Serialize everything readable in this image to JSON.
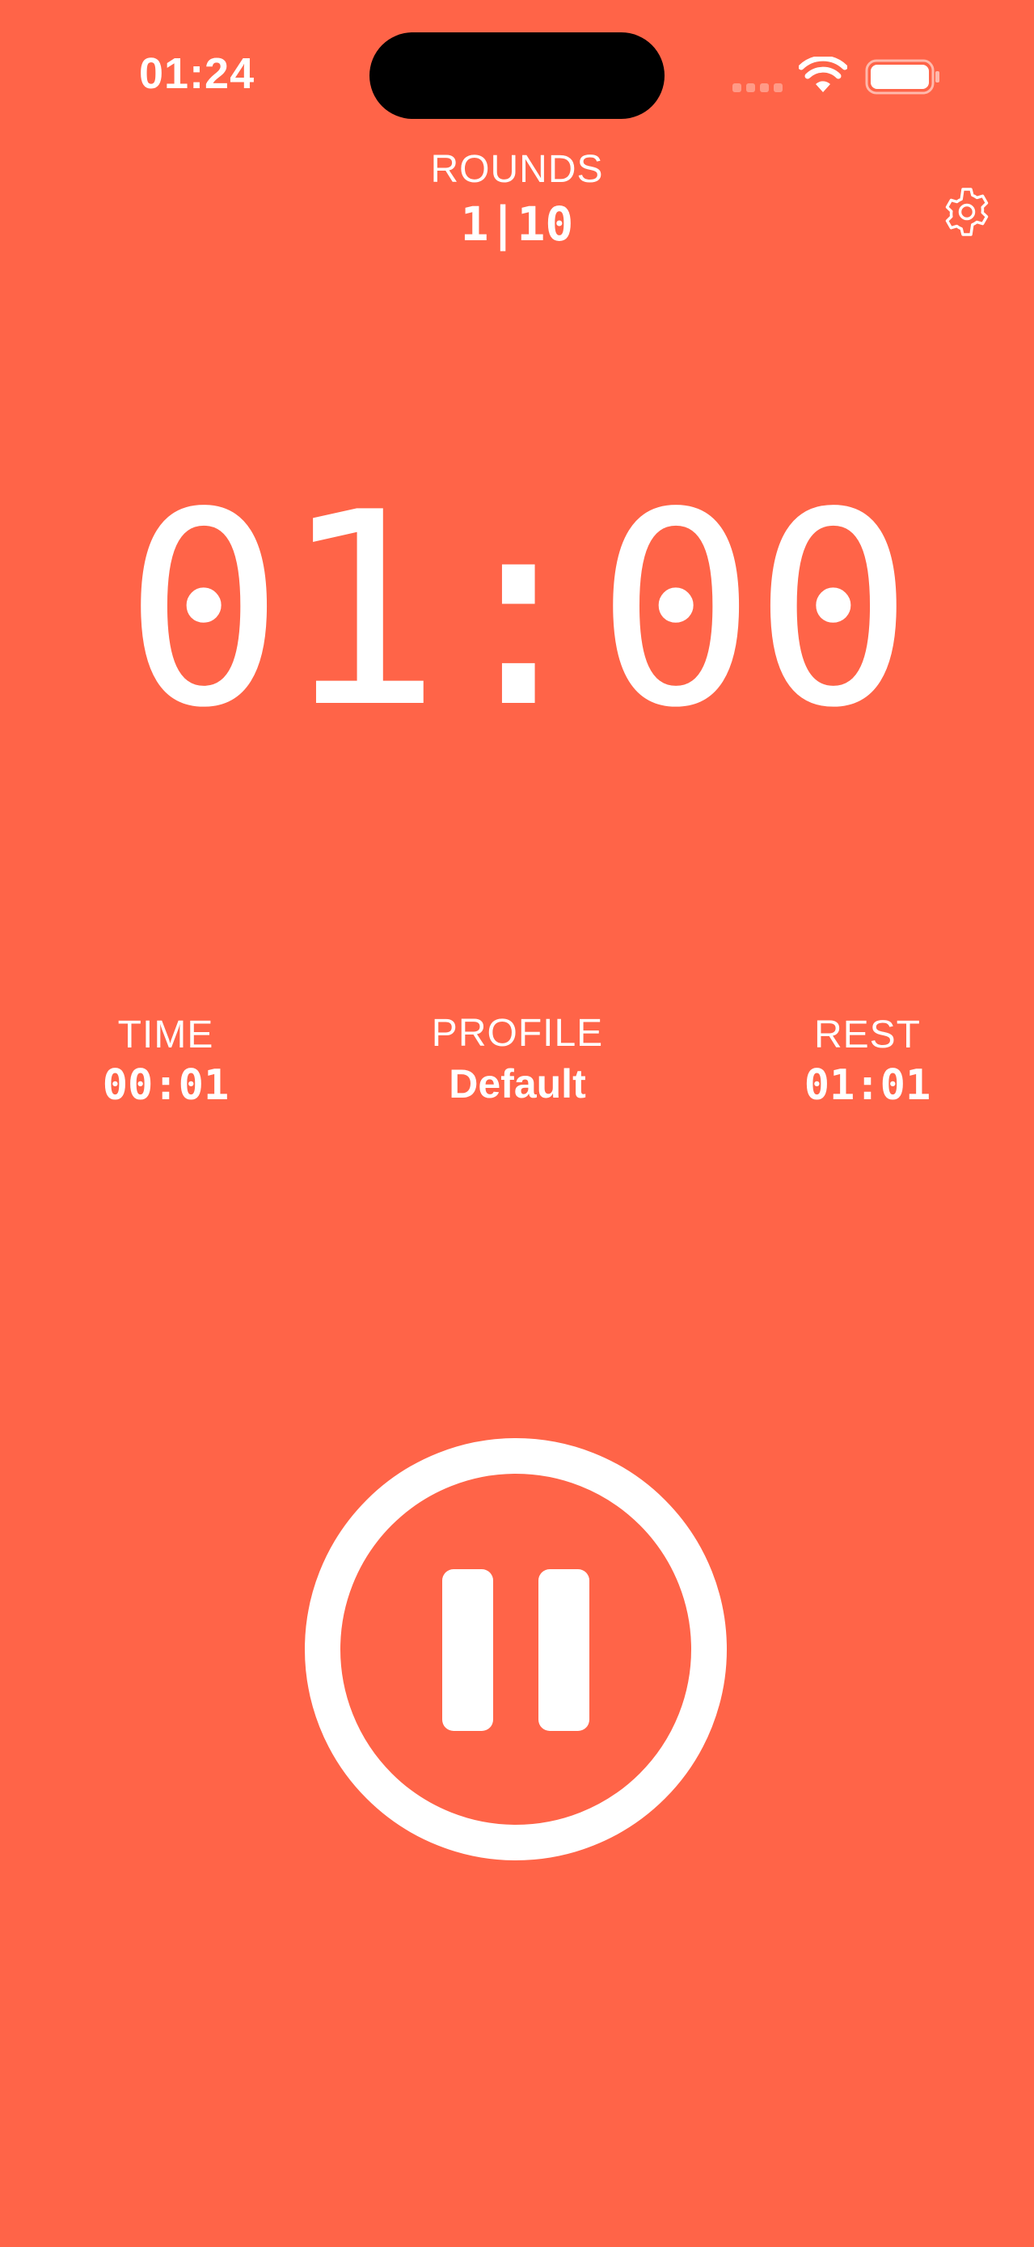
{
  "status_bar": {
    "time": "01:24",
    "icons": [
      "signal-icon",
      "wifi-icon",
      "battery-icon"
    ]
  },
  "rounds": {
    "label": "ROUNDS",
    "value": "1|10"
  },
  "settings": {
    "icon": "gear-icon"
  },
  "timer": {
    "value": "01:00"
  },
  "stats": {
    "time": {
      "label": "TIME",
      "value": "00:01"
    },
    "profile": {
      "label": "PROFILE",
      "value": "Default"
    },
    "rest": {
      "label": "REST",
      "value": "01:01"
    }
  },
  "controls": {
    "pause_icon": "pause-icon"
  },
  "colors": {
    "background": "#FF6448",
    "foreground": "#FFFFFF"
  }
}
